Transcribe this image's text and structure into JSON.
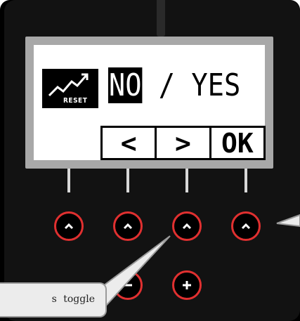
{
  "screen": {
    "icon_label": "RESET",
    "choice_selected": "NO",
    "choice_separator": " / ",
    "choice_other": "YES",
    "softkeys": [
      {
        "label": "<",
        "name": "softkey-left"
      },
      {
        "label": ">",
        "name": "softkey-right"
      },
      {
        "label": "OK",
        "name": "softkey-ok"
      }
    ]
  },
  "hardware_buttons": {
    "row_icon": "chevron-up-icon",
    "minus_icon": "minus-icon",
    "plus_icon": "plus-icon"
  },
  "callout": {
    "text": "s  toggle"
  },
  "colors": {
    "button_ring": "#e03030",
    "device_body": "#121212",
    "lcd_background": "#ffffff"
  }
}
